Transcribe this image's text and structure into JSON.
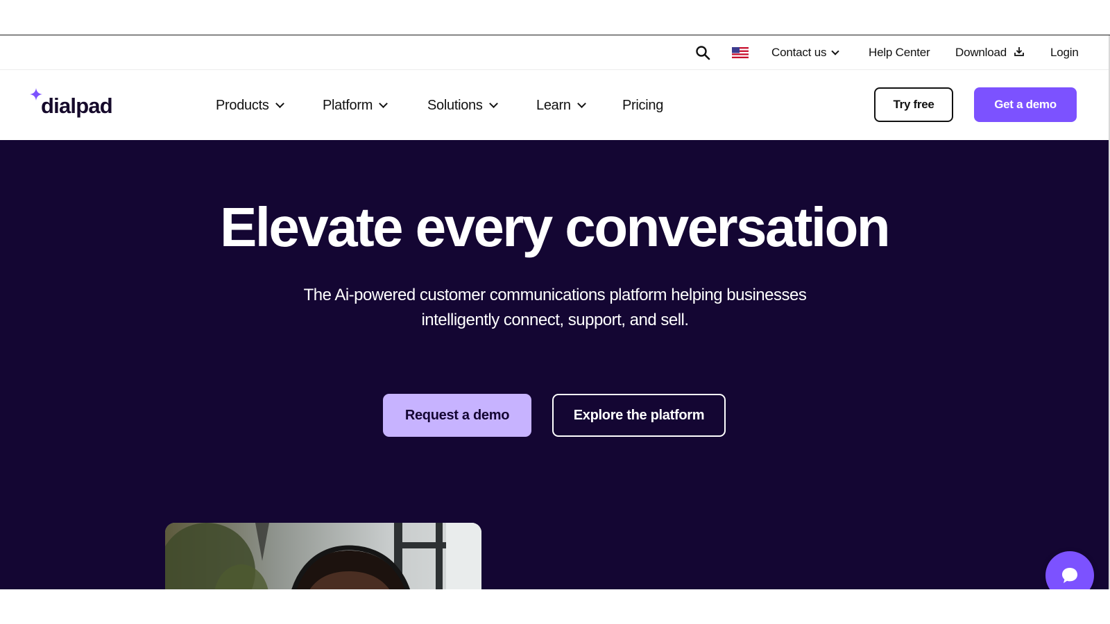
{
  "utility_bar": {
    "search_icon": "search-icon",
    "flag_icon": "us-flag-icon",
    "contact_label": "Contact us",
    "help_label": "Help Center",
    "download_label": "Download",
    "download_icon": "download-icon",
    "login_label": "Login"
  },
  "nav": {
    "logo_text": "dialpad",
    "logo_icon": "sparkle-icon",
    "items": [
      {
        "label": "Products",
        "dropdown": true
      },
      {
        "label": "Platform",
        "dropdown": true
      },
      {
        "label": "Solutions",
        "dropdown": true
      },
      {
        "label": "Learn",
        "dropdown": true
      },
      {
        "label": "Pricing",
        "dropdown": false
      }
    ],
    "try_free_label": "Try free",
    "get_demo_label": "Get a demo"
  },
  "hero": {
    "title": "Elevate every conversation",
    "subtitle_line1": "The Ai-powered customer communications platform helping businesses",
    "subtitle_line2": "intelligently connect, support, and sell.",
    "request_demo_label": "Request a demo",
    "explore_label": "Explore the platform"
  },
  "chat": {
    "icon": "chat-bubble-icon"
  },
  "colors": {
    "brand_purple": "#7c52ff",
    "hero_bg": "#140633",
    "light_purple": "#c7b3ff"
  }
}
